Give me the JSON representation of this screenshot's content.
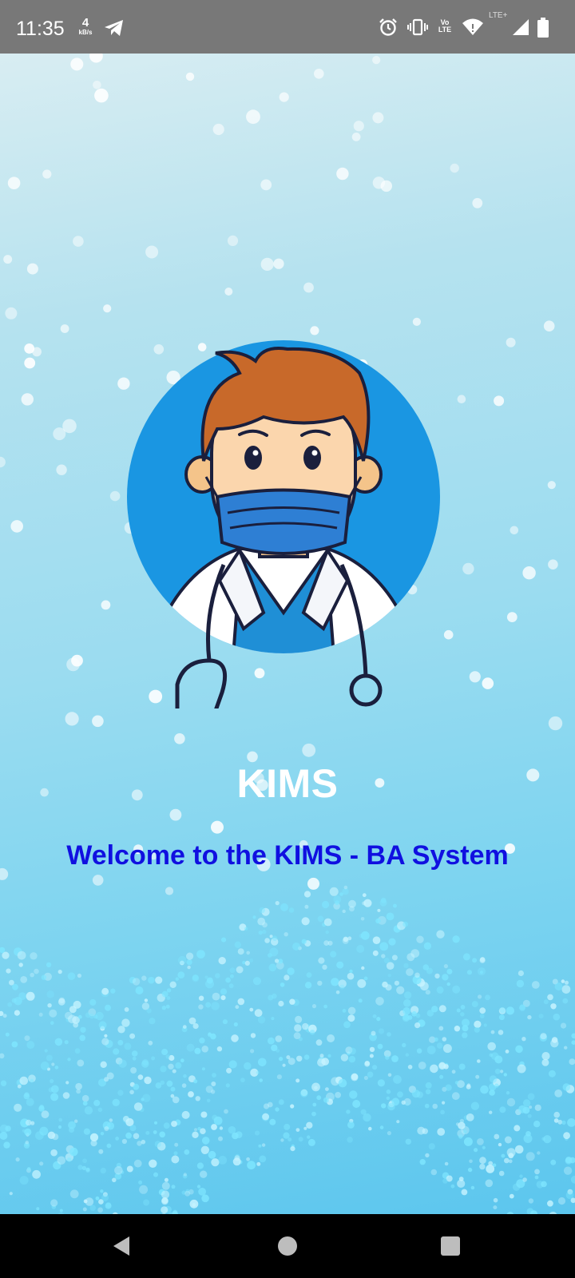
{
  "status_bar": {
    "time": "11:35",
    "net_speed_value": "4",
    "net_speed_unit": "kB/s",
    "icons": [
      "telegram-icon",
      "alarm-icon",
      "vibrate-icon",
      "volte-icon",
      "wifi-icon",
      "lte-signal-icon",
      "battery-icon"
    ],
    "volte_label_top": "Vo",
    "volte_label_bottom": "LTE",
    "lte_plus_label": "LTE+"
  },
  "splash": {
    "app_title": "KIMS",
    "welcome_text": "Welcome to the KIMS - BA System",
    "illustration": "doctor-with-mask-illustration"
  },
  "colors": {
    "title": "#ffffff",
    "welcome": "#1010e0",
    "avatar_circle": "#1a96e2",
    "status_bar_bg": "#787878"
  },
  "nav_bar": {
    "buttons": [
      "back",
      "home",
      "recents"
    ]
  }
}
